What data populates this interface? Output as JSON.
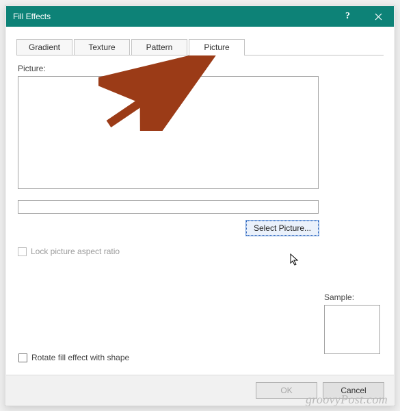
{
  "title": "Fill Effects",
  "tabs": [
    {
      "label": "Gradient",
      "active": false
    },
    {
      "label": "Texture",
      "active": false
    },
    {
      "label": "Pattern",
      "active": false
    },
    {
      "label": "Picture",
      "active": true
    }
  ],
  "panel": {
    "picture_label": "Picture:",
    "filename_value": "",
    "select_button": "Select Picture...",
    "lock_aspect_label": "Lock picture aspect ratio",
    "lock_aspect_checked": false,
    "lock_aspect_enabled": false,
    "sample_label": "Sample:",
    "rotate_label": "Rotate fill effect with shape",
    "rotate_checked": false
  },
  "footer": {
    "ok_label": "OK",
    "ok_enabled": false,
    "cancel_label": "Cancel"
  },
  "watermark": "groovyPost.com",
  "colors": {
    "titlebar": "#0d8277",
    "arrow": "#9b3b17"
  }
}
